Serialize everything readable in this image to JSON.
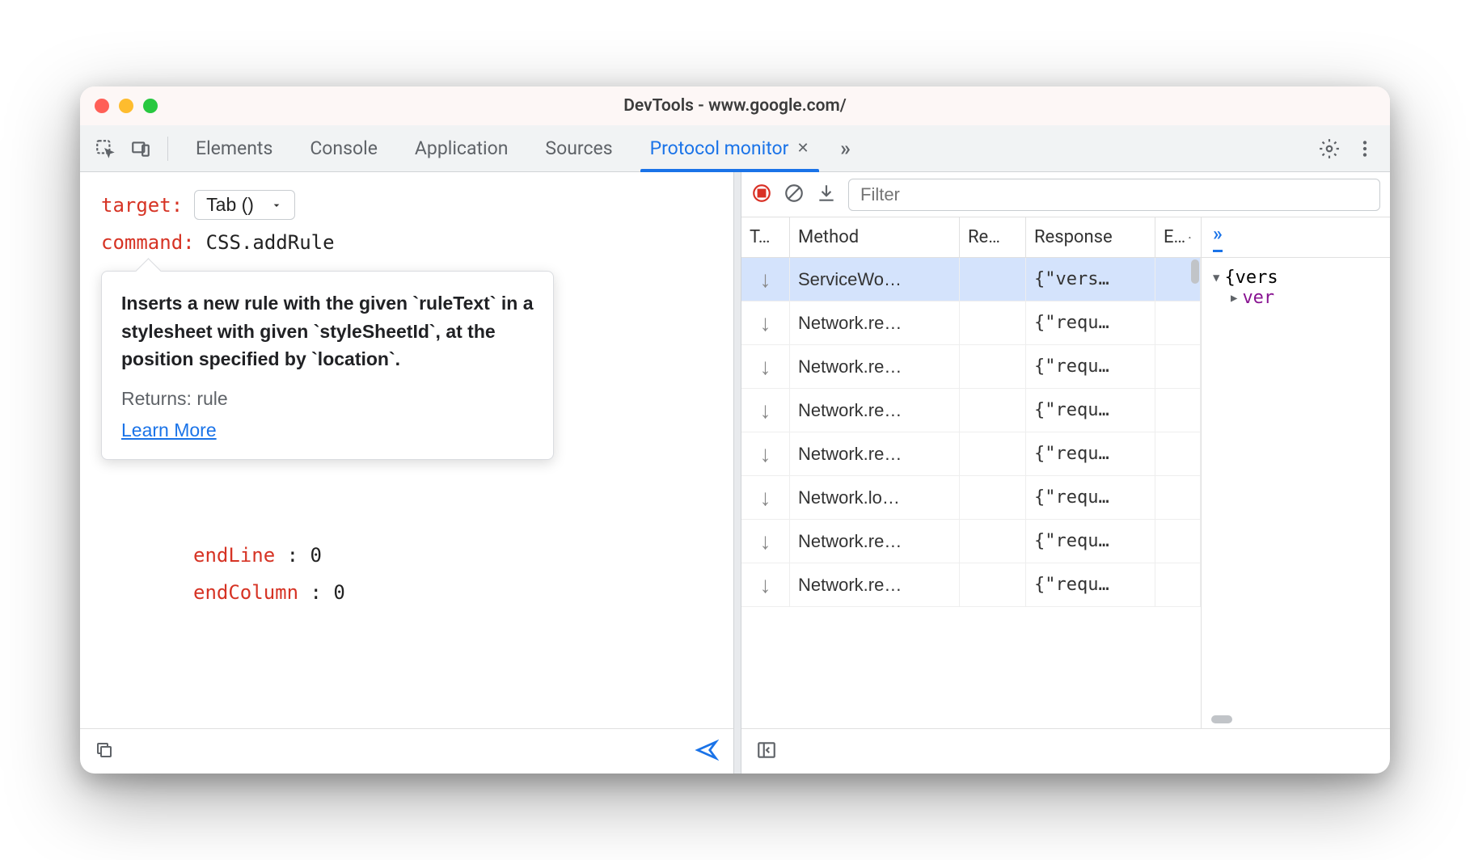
{
  "window": {
    "title": "DevTools - www.google.com/"
  },
  "tabbar": {
    "tabs": [
      {
        "label": "Elements"
      },
      {
        "label": "Console"
      },
      {
        "label": "Application"
      },
      {
        "label": "Sources"
      },
      {
        "label": "Protocol monitor"
      }
    ],
    "active_index": 4,
    "overflow": "»"
  },
  "left": {
    "target_label": "target",
    "target_value": "Tab ()",
    "command_label": "command",
    "command_value": "CSS.addRule",
    "tooltip": {
      "description": "Inserts a new rule with the given `ruleText` in a stylesheet with given `styleSheetId`, at the position specified by `location`.",
      "returns": "Returns: rule",
      "learn_more": "Learn More"
    },
    "params": [
      {
        "name": "endLine",
        "value": "0"
      },
      {
        "name": "endColumn",
        "value": "0"
      }
    ]
  },
  "right": {
    "filter_placeholder": "Filter",
    "table": {
      "headers": {
        "type": "T…",
        "method": "Method",
        "request": "Re…",
        "response": "Response",
        "elapsed": "E…"
      },
      "rows": [
        {
          "method": "ServiceWo…",
          "response": "{\"vers…"
        },
        {
          "method": "Network.re…",
          "response": "{\"requ…"
        },
        {
          "method": "Network.re…",
          "response": "{\"requ…"
        },
        {
          "method": "Network.re…",
          "response": "{\"requ…"
        },
        {
          "method": "Network.re…",
          "response": "{\"requ…"
        },
        {
          "method": "Network.lo…",
          "response": "{\"requ…"
        },
        {
          "method": "Network.re…",
          "response": "{\"requ…"
        },
        {
          "method": "Network.re…",
          "response": "{\"requ…"
        }
      ],
      "selected_index": 0
    },
    "tree": {
      "overflow": "»",
      "root_label": "{vers",
      "child_key": "ver"
    }
  }
}
